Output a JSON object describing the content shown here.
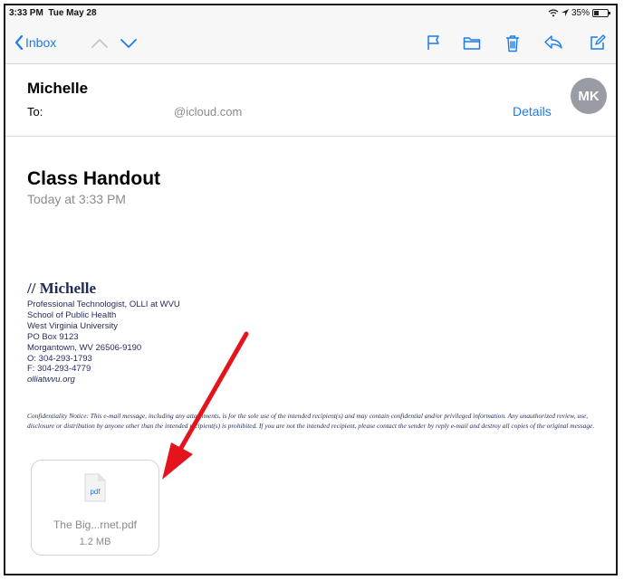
{
  "status": {
    "time": "3:33 PM",
    "date": "Tue May 28",
    "battery": "35%"
  },
  "toolbar": {
    "back_label": "Inbox",
    "icons": [
      "chevron-left-icon",
      "chevron-up-icon",
      "chevron-down-icon",
      "flag-icon",
      "folder-icon",
      "trash-icon",
      "reply-icon",
      "compose-icon"
    ]
  },
  "header": {
    "sender": "Michelle",
    "to_label": "To:",
    "to_value": "@icloud.com",
    "details_label": "Details",
    "avatar_initials": "MK"
  },
  "message": {
    "subject": "Class Handout",
    "date": "Today at 3:33 PM"
  },
  "signature": {
    "name": "// Michelle",
    "lines": [
      "Professional Technologist, OLLI at WVU",
      "School of Public Health",
      "West Virginia University",
      "PO Box 9123",
      "Morgantown, WV 26506-9190",
      "O: 304-293-1793",
      "F: 304-293-4779"
    ],
    "link": "olliatwvu.org"
  },
  "notice": "Confidentiality Notice: This e-mail message, including any attachments, is for the sole use of the intended recipient(s) and may contain confidential and/or privileged information. Any unauthorized review, use, disclosure or distribution by anyone other than the intended recipient(s) is prohibited. If you are not the intended recipient, please contact the sender by reply e-mail and destroy all copies of the original message.",
  "attachment": {
    "type_label": "pdf",
    "name": "The Big...rnet.pdf",
    "size": "1.2 MB"
  },
  "colors": {
    "accent": "#1a7cf0",
    "avatar": "#9a9ca3",
    "arrow": "#e5141b",
    "signature": "#1f2a5a"
  }
}
